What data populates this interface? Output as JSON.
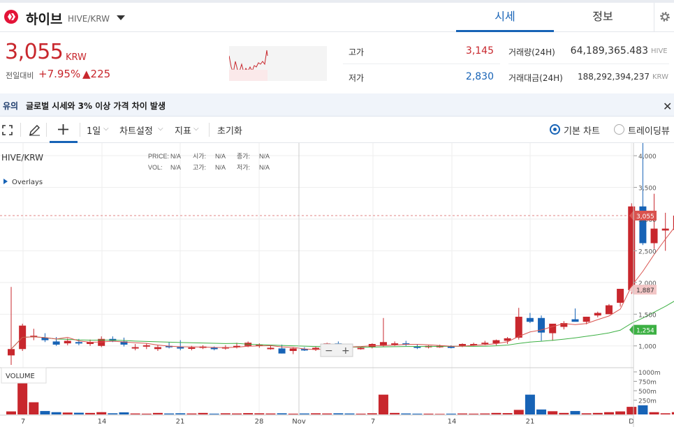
{
  "header": {
    "coin_name": "하이브",
    "pair": "HIVE/KRW",
    "tabs": [
      "시세",
      "정보"
    ]
  },
  "ticker": {
    "price": "3,055",
    "currency": "KRW",
    "change_label": "전일대비",
    "change_pct": "+7.95%",
    "change_amt": "▲225",
    "high_label": "고가",
    "high": "3,145",
    "low_label": "저가",
    "low": "2,830",
    "vol_label": "거래량(24H)",
    "vol": "64,189,365.483",
    "vol_unit": "HIVE",
    "amt_label": "거래대금(24H)",
    "amt": "188,292,394,237",
    "amt_unit": "KRW"
  },
  "notice": {
    "tag": "유의",
    "text": "글로벌 시세와 3% 이상 가격 차이 발생"
  },
  "toolbar": {
    "interval": "1일",
    "chart_settings": "차트설정",
    "indicators": "지표",
    "reset": "초기화",
    "basic_chart": "기본 차트",
    "tradingview": "트레이딩뷰"
  },
  "chart_info": {
    "symbol": "HIVE/KRW",
    "price_lbl": "PRICE:",
    "open_lbl": "시가:",
    "close_lbl": "종가:",
    "vol_lbl": "VOL:",
    "high_lbl": "고가:",
    "low_lbl": "저가:",
    "na": "N/A",
    "overlays": "Overlays",
    "volume": "VOLUME"
  },
  "colors": {
    "up": "#c8272d",
    "down": "#1763b6",
    "ma1": "#d9534f",
    "ma2": "#3cb043"
  },
  "chart_data": {
    "type": "candlestick",
    "ylim": [
      700,
      4200
    ],
    "y_ticks": [
      "4,000",
      "3,500",
      "3,000",
      "2,500",
      "2,000",
      "1,500",
      "1,000"
    ],
    "vol_ticks": [
      "1000m",
      "750m",
      "500m",
      "250m"
    ],
    "x_ticks": [
      "7",
      "14",
      "21",
      "28",
      "Nov",
      "7",
      "14",
      "21",
      "D"
    ],
    "last_price_tag": "3,055",
    "ma1_tag": "1,887",
    "ma2_tag": "1,254",
    "last_price": 3055,
    "ma1_last": 1887,
    "ma2_last": 1254,
    "candles": [
      [
        850,
        1930,
        700,
        950,
        80
      ],
      [
        950,
        1350,
        920,
        1320,
        1080
      ],
      [
        1150,
        1270,
        1090,
        1160,
        320
      ],
      [
        1130,
        1200,
        1060,
        1090,
        90
      ],
      [
        1070,
        1140,
        1000,
        1020,
        60
      ],
      [
        1040,
        1120,
        1010,
        1080,
        50
      ],
      [
        1060,
        1110,
        1010,
        1040,
        45
      ],
      [
        1030,
        1100,
        1000,
        1060,
        40
      ],
      [
        1000,
        1150,
        980,
        1110,
        60
      ],
      [
        1110,
        1150,
        1060,
        1080,
        30
      ],
      [
        1070,
        1130,
        990,
        1020,
        55
      ],
      [
        960,
        1030,
        930,
        980,
        25
      ],
      [
        990,
        1040,
        950,
        1010,
        20
      ],
      [
        950,
        1010,
        920,
        980,
        40
      ],
      [
        1000,
        1060,
        960,
        990,
        25
      ],
      [
        980,
        1090,
        930,
        970,
        30
      ],
      [
        960,
        1000,
        930,
        975,
        25
      ],
      [
        980,
        1010,
        950,
        990,
        40
      ],
      [
        970,
        990,
        930,
        950,
        20
      ],
      [
        960,
        1010,
        940,
        980,
        30
      ],
      [
        980,
        1050,
        960,
        1000,
        25
      ],
      [
        1000,
        1070,
        980,
        1050,
        35
      ],
      [
        1000,
        1040,
        970,
        1020,
        30
      ],
      [
        960,
        1000,
        940,
        970,
        25
      ],
      [
        960,
        1020,
        880,
        880,
        30
      ],
      [
        920,
        980,
        870,
        960,
        20
      ],
      [
        950,
        980,
        920,
        930,
        25
      ],
      [
        940,
        990,
        920,
        970,
        30
      ],
      [
        1000,
        1050,
        980,
        1040,
        25
      ],
      [
        1040,
        1070,
        990,
        1010,
        30
      ],
      [
        1000,
        1010,
        950,
        960,
        25
      ],
      [
        960,
        990,
        940,
        970,
        20
      ],
      [
        980,
        1040,
        960,
        1030,
        30
      ],
      [
        1010,
        1440,
        990,
        1060,
        520
      ],
      [
        1030,
        1070,
        1000,
        1040,
        40
      ],
      [
        1040,
        1080,
        1000,
        1020,
        25
      ],
      [
        990,
        1020,
        950,
        970,
        20
      ],
      [
        980,
        1010,
        960,
        1000,
        20
      ],
      [
        990,
        1020,
        970,
        1000,
        15
      ],
      [
        990,
        1010,
        960,
        980,
        20
      ],
      [
        1000,
        1040,
        980,
        1030,
        25
      ],
      [
        1020,
        1050,
        1000,
        1030,
        20
      ],
      [
        1030,
        1080,
        1010,
        1050,
        25
      ],
      [
        1040,
        1100,
        1010,
        1090,
        40
      ],
      [
        1080,
        1140,
        1030,
        1120,
        35
      ],
      [
        1130,
        1600,
        1100,
        1460,
        120
      ],
      [
        1440,
        1520,
        1360,
        1380,
        520
      ],
      [
        1440,
        1480,
        1080,
        1210,
        130
      ],
      [
        1200,
        1290,
        1080,
        1350,
        85
      ],
      [
        1300,
        1390,
        1260,
        1360,
        40
      ],
      [
        1420,
        1590,
        1400,
        1380,
        90
      ],
      [
        1380,
        1460,
        1340,
        1460,
        30
      ],
      [
        1480,
        1540,
        1450,
        1520,
        40
      ],
      [
        1500,
        1660,
        1500,
        1640,
        60
      ],
      [
        1680,
        1900,
        1620,
        1900,
        80
      ],
      [
        1880,
        3250,
        1820,
        3200,
        200
      ],
      [
        3200,
        4200,
        2590,
        2620,
        240
      ],
      [
        2620,
        3400,
        2530,
        2850,
        60
      ],
      [
        2820,
        3100,
        2500,
        2850,
        30
      ],
      [
        2830,
        3145,
        2830,
        3055,
        60
      ]
    ]
  }
}
